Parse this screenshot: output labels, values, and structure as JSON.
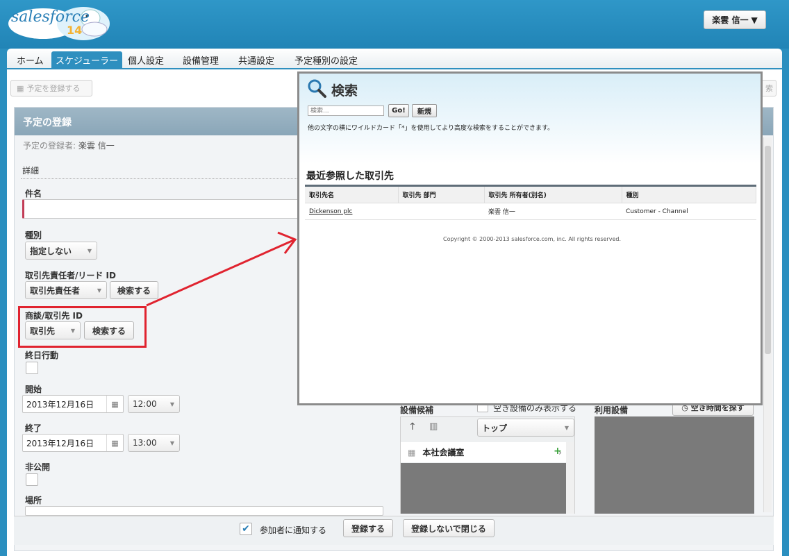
{
  "header": {
    "logo_text": "salesforce",
    "logo_badge": "14",
    "user_menu": "楽雲 信一"
  },
  "tabs": [
    {
      "label": "ホーム",
      "active": false
    },
    {
      "label": "スケジューラー",
      "active": true
    },
    {
      "label": "個人設定",
      "active": false
    },
    {
      "label": "設備管理",
      "active": false
    },
    {
      "label": "共通設定",
      "active": false
    },
    {
      "label": "予定種別の設定",
      "active": false
    }
  ],
  "toolbar": {
    "register_event": "予定を登録する",
    "right_button": "索"
  },
  "form": {
    "title": "予定の登録",
    "registrant_label": "予定の登録者:",
    "registrant_name": "楽雲 信一",
    "section_detail": "詳細",
    "subject_label": "件名",
    "type_label": "種別",
    "type_value": "指定しない",
    "contact_label": "取引先責任者/リード ID",
    "contact_value": "取引先責任者",
    "search_button": "検索する",
    "deal_label": "商談/取引先 ID",
    "deal_value": "取引先",
    "allday_label": "終日行動",
    "start_label": "開始",
    "start_date": "2013年12月16日",
    "start_time": "12:00",
    "end_label": "終了",
    "end_date": "2013年12月16日",
    "end_time": "13:00",
    "private_label": "非公開",
    "location_label": "場所"
  },
  "equipment": {
    "candidates_label": "設備候補",
    "only_available": "空き設備のみ表示する",
    "in_use_label": "利用設備",
    "find_free_time": "空き時間を探す",
    "top_select": "トップ",
    "hq_room": "本社会議室"
  },
  "bottom": {
    "notify_label": "参加者に通知する",
    "notify_checked": true,
    "register_button": "登録する",
    "close_button": "登録しないで閉じる"
  },
  "popup": {
    "title": "検索",
    "search_placeholder": "検索...",
    "go_button": "Go!",
    "new_button": "新規",
    "help_text": "他の文字の横にワイルドカード「*」を使用してより高度な検索をすることができます。",
    "recent_title": "最近参照した取引先",
    "columns": [
      "取引先名",
      "取引先 部門",
      "取引先 所有者(別名)",
      "種別"
    ],
    "rows": [
      [
        "Dickenson plc",
        "",
        "楽雲 信一",
        "Customer - Channel"
      ]
    ],
    "copyright": "Copyright © 2000-2013 salesforce.com, inc. All rights reserved."
  },
  "colors": {
    "brand": "#2b8fbf",
    "highlight": "#e0232f",
    "required": "#c23c56"
  }
}
